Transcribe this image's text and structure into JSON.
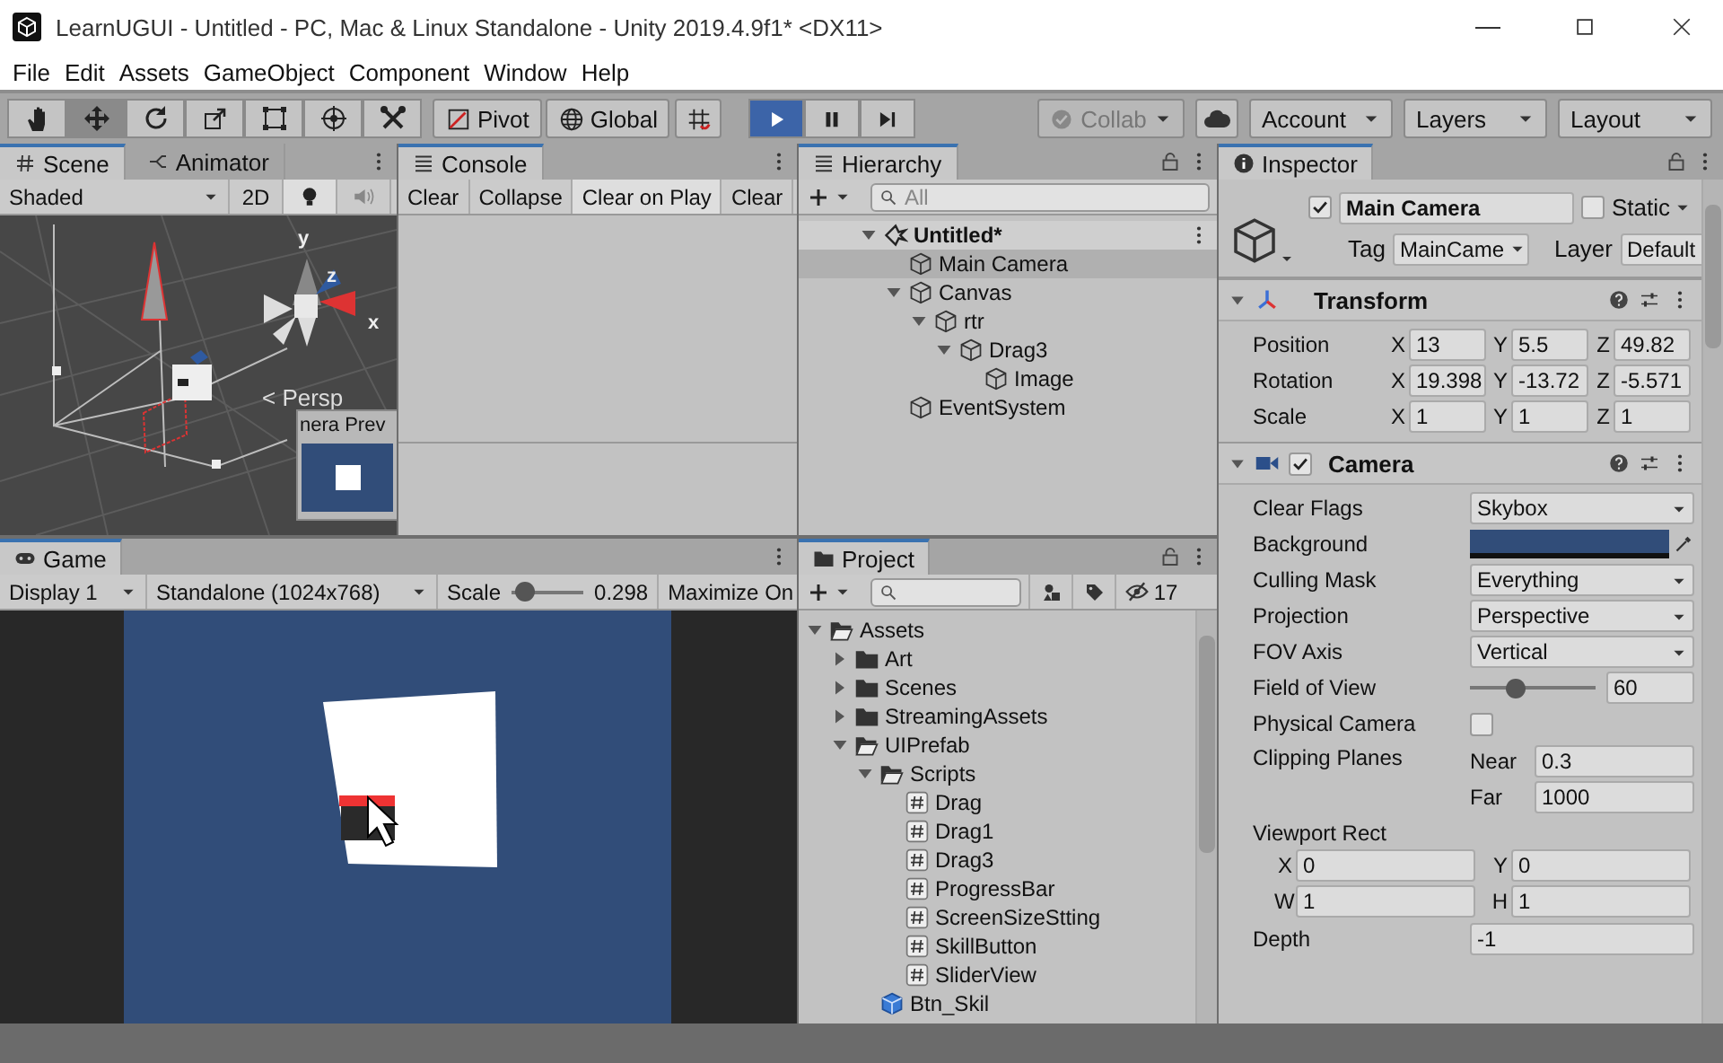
{
  "window": {
    "title": "LearnUGUI - Untitled - PC, Mac & Linux Standalone - Unity 2019.4.9f1* <DX11>"
  },
  "menu": [
    "File",
    "Edit",
    "Assets",
    "GameObject",
    "Component",
    "Window",
    "Help"
  ],
  "toolbar": {
    "tools": [
      {
        "kind": "hand",
        "selected": false
      },
      {
        "kind": "move",
        "selected": true
      },
      {
        "kind": "rotate",
        "selected": false
      },
      {
        "kind": "scale",
        "selected": false
      },
      {
        "kind": "rect",
        "selected": false
      },
      {
        "kind": "transform",
        "selected": false
      },
      {
        "kind": "custom",
        "selected": false
      }
    ],
    "pivot": "Pivot",
    "global": "Global",
    "playback": [
      {
        "kind": "play",
        "on": true
      },
      {
        "kind": "pause",
        "on": false
      },
      {
        "kind": "step",
        "on": false
      }
    ],
    "collab": {
      "label": "Collab",
      "disabled": true
    },
    "menus": [
      "Account",
      "Layers",
      "Layout"
    ]
  },
  "scene": {
    "tabs": [
      {
        "kind": "scene",
        "label": "Scene",
        "selected": true
      },
      {
        "kind": "animator",
        "label": "Animator",
        "selected": false
      }
    ],
    "shading": "Shaded",
    "mode_2d": {
      "label": "2D",
      "on": false
    },
    "lighting": {
      "on": true
    },
    "audio": {
      "on": false
    },
    "axis_labels": [
      "y",
      "z",
      "x"
    ],
    "projection": "< Persp",
    "camera_preview": {
      "title": "nera Prev"
    }
  },
  "console": {
    "tabs": [
      {
        "kind": "console",
        "label": "Console",
        "selected": true
      }
    ],
    "buttons": [
      {
        "label": "Clear",
        "on": false
      },
      {
        "label": "Collapse",
        "on": false
      },
      {
        "label": "Clear on Play",
        "on": true
      },
      {
        "label": "Clear",
        "on": false
      }
    ]
  },
  "hierarchy": {
    "tabs": [
      {
        "kind": "hierarchy",
        "label": "Hierarchy",
        "selected": true
      }
    ],
    "search": {
      "placeholder": "All"
    },
    "tree": [
      {
        "kind": "scene",
        "label": "Untitled*",
        "selected": false,
        "expanded": true,
        "children": [
          {
            "kind": "object",
            "label": "Main Camera",
            "selected": true
          },
          {
            "kind": "object",
            "label": "Canvas",
            "selected": false,
            "expanded": true,
            "children": [
              {
                "kind": "object",
                "label": "rtr",
                "selected": false,
                "expanded": true,
                "children": [
                  {
                    "kind": "object",
                    "label": "Drag3",
                    "selected": false,
                    "expanded": true,
                    "children": [
                      {
                        "kind": "object",
                        "label": "Image",
                        "selected": false
                      }
                    ]
                  }
                ]
              }
            ]
          },
          {
            "kind": "object",
            "label": "EventSystem",
            "selected": false
          }
        ]
      }
    ]
  },
  "game": {
    "tabs": [
      {
        "kind": "game",
        "label": "Game",
        "selected": true
      }
    ],
    "display": "Display 1",
    "resolution": "Standalone (1024x768)",
    "scale": {
      "label": "Scale",
      "level": 0.06,
      "reading": "0.298"
    },
    "maximize": "Maximize On"
  },
  "project": {
    "tabs": [
      {
        "kind": "project",
        "label": "Project",
        "selected": true
      }
    ],
    "hidden_count": "17",
    "tree": [
      {
        "kind": "folder",
        "label": "Assets",
        "selected": false,
        "expanded": true,
        "children": [
          {
            "kind": "folder",
            "label": "Art",
            "selected": false,
            "expanded": false
          },
          {
            "kind": "folder",
            "label": "Scenes",
            "selected": false,
            "expanded": false
          },
          {
            "kind": "folder",
            "label": "StreamingAssets",
            "selected": false,
            "expanded": false
          },
          {
            "kind": "folder",
            "label": "UIPrefab",
            "selected": false,
            "expanded": true,
            "children": [
              {
                "kind": "folder",
                "label": "Scripts",
                "selected": false,
                "expanded": true,
                "children": [
                  {
                    "kind": "script",
                    "label": "Drag",
                    "selected": false
                  },
                  {
                    "kind": "script",
                    "label": "Drag1",
                    "selected": false
                  },
                  {
                    "kind": "script",
                    "label": "Drag3",
                    "selected": false
                  },
                  {
                    "kind": "script",
                    "label": "ProgressBar",
                    "selected": false
                  },
                  {
                    "kind": "script",
                    "label": "ScreenSizeStting",
                    "selected": false
                  },
                  {
                    "kind": "script",
                    "label": "SkillButton",
                    "selected": false
                  },
                  {
                    "kind": "script",
                    "label": "SliderView",
                    "selected": false
                  }
                ]
              },
              {
                "kind": "prefab",
                "label": "Btn_Skil",
                "selected": false
              }
            ]
          }
        ]
      }
    ]
  },
  "inspector": {
    "tabs": [
      {
        "kind": "inspector",
        "label": "Inspector",
        "selected": true
      }
    ],
    "object": {
      "active": true,
      "name": "Main Camera",
      "static": {
        "label": "Static",
        "checked": false
      },
      "tag": {
        "label": "Tag",
        "value": "MainCame"
      },
      "layer": {
        "label": "Layer",
        "value": "Default"
      }
    },
    "components": [
      {
        "kind": "transform",
        "title": "Transform",
        "rows": [
          {
            "kind": "vector",
            "label": "Position",
            "fields": [
              {
                "axis": "X",
                "value": "13"
              },
              {
                "axis": "Y",
                "value": "5.5"
              },
              {
                "axis": "Z",
                "value": "49.82"
              }
            ]
          },
          {
            "kind": "vector",
            "label": "Rotation",
            "fields": [
              {
                "axis": "X",
                "value": "19.398"
              },
              {
                "axis": "Y",
                "value": "-13.72"
              },
              {
                "axis": "Z",
                "value": "-5.571"
              }
            ]
          },
          {
            "kind": "vector",
            "label": "Scale",
            "fields": [
              {
                "axis": "X",
                "value": "1"
              },
              {
                "axis": "Y",
                "value": "1"
              },
              {
                "axis": "Z",
                "value": "1"
              }
            ]
          }
        ]
      },
      {
        "kind": "camera",
        "title": "Camera",
        "enabled": true,
        "rows": [
          {
            "kind": "dropdown",
            "label": "Clear Flags",
            "value": "Skybox"
          },
          {
            "kind": "color",
            "label": "Background",
            "color": "#314d79"
          },
          {
            "kind": "dropdown",
            "label": "Culling Mask",
            "value": "Everything"
          },
          {
            "kind": "dropdown",
            "label": "Projection",
            "value": "Perspective"
          },
          {
            "kind": "dropdown",
            "label": "FOV Axis",
            "value": "Vertical"
          },
          {
            "kind": "slider",
            "label": "Field of View",
            "level": 0.34,
            "value": "60"
          },
          {
            "kind": "checkbox",
            "label": "Physical Camera",
            "checked": false
          },
          {
            "kind": "planes",
            "label": "Clipping Planes",
            "fields": [
              {
                "axis": "Near",
                "value": "0.3"
              },
              {
                "axis": "Far",
                "value": "1000"
              }
            ]
          },
          {
            "kind": "rect",
            "label": "Viewport Rect",
            "fields": [
              {
                "axis": "X",
                "value": "0"
              },
              {
                "axis": "Y",
                "value": "0"
              },
              {
                "axis": "W",
                "value": "1"
              },
              {
                "axis": "H",
                "value": "1"
              }
            ]
          },
          {
            "kind": "field",
            "label": "Depth",
            "value": "-1"
          }
        ]
      }
    ]
  }
}
